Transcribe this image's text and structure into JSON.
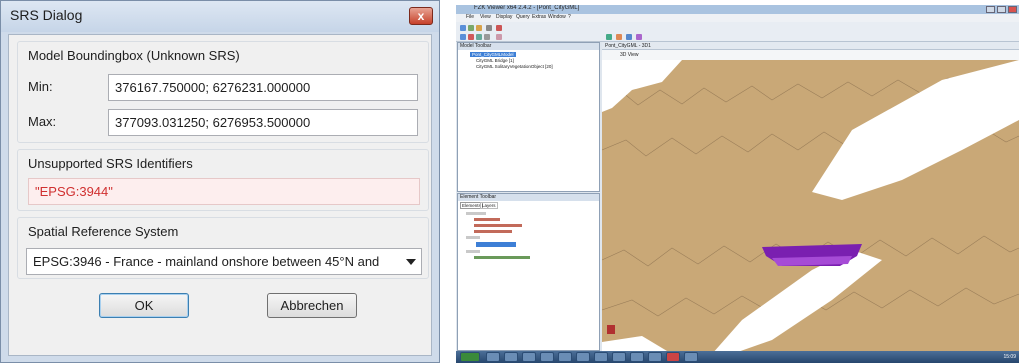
{
  "dialog": {
    "title": "SRS Dialog",
    "close_glyph": "x",
    "bbox_group": {
      "title": "Model Boundingbox (Unknown SRS)",
      "min_label": "Min:",
      "min_value": "376167.750000; 6276231.000000",
      "max_label": "Max:",
      "max_value": "377093.031250; 6276953.500000"
    },
    "unsupported_group": {
      "title": "Unsupported SRS Identifiers",
      "value": "\"EPSG:3944\""
    },
    "srs_group": {
      "title": "Spatial Reference System",
      "selected": "EPSG:3946 - France - mainland onshore between 45°N and"
    },
    "ok_label": "OK",
    "cancel_label": "Abbrechen"
  },
  "app": {
    "title": "FZK Viewer x64 2.4.2 - [Pont_CityGML]",
    "menu": [
      "File",
      "View",
      "Display",
      "Query",
      "Extras",
      "Window",
      "?"
    ],
    "object_tree": {
      "header": "Model Toolbar",
      "rows": [
        "Pont_CityGMLModel",
        "CityGML Bridge [1]",
        "CityGML SolitaryVegetationObject [20]"
      ]
    },
    "element_tree": {
      "header": "Element Toolbar",
      "tabs": [
        "Elements",
        "Layers"
      ]
    },
    "view": {
      "tab": "Pont_CityGML - 3D1",
      "sub": "3D View"
    },
    "clock": "15:09",
    "colors": {
      "terrain": "#c9a877",
      "bridge": "#7a1fb0",
      "selection": "#3d7fd6",
      "error_text": "#d03030"
    }
  }
}
